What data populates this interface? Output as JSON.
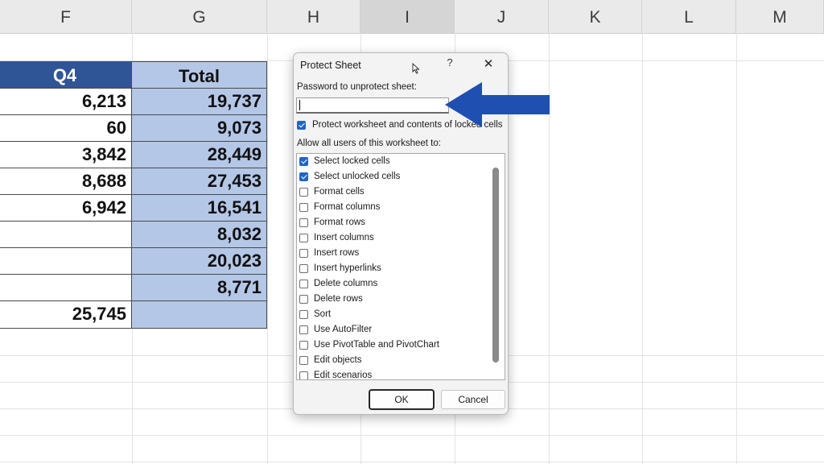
{
  "columns": [
    "F",
    "G",
    "H",
    "I",
    "J",
    "K",
    "L",
    "M"
  ],
  "selected_column": "I",
  "table": {
    "q4_header": "Q4",
    "total_header": "Total",
    "q4_values": [
      "6,213",
      "60",
      "3,842",
      "8,688",
      "6,942",
      "",
      "",
      "",
      "25,745"
    ],
    "total_values": [
      "19,737",
      "9,073",
      "28,449",
      "27,453",
      "16,541",
      "8,032",
      "20,023",
      "8,771",
      ""
    ]
  },
  "dialog": {
    "title": "Protect Sheet",
    "help": "?",
    "close": "✕",
    "password_label": "Password to unprotect sheet:",
    "password_value": "",
    "protect_label": "Protect worksheet and contents of locked cells",
    "protect_checked": true,
    "allow_label": "Allow all users of this worksheet to:",
    "options": [
      {
        "label": "Select locked cells",
        "checked": true
      },
      {
        "label": "Select unlocked cells",
        "checked": true
      },
      {
        "label": "Format cells",
        "checked": false
      },
      {
        "label": "Format columns",
        "checked": false
      },
      {
        "label": "Format rows",
        "checked": false
      },
      {
        "label": "Insert columns",
        "checked": false
      },
      {
        "label": "Insert rows",
        "checked": false
      },
      {
        "label": "Insert hyperlinks",
        "checked": false
      },
      {
        "label": "Delete columns",
        "checked": false
      },
      {
        "label": "Delete rows",
        "checked": false
      },
      {
        "label": "Sort",
        "checked": false
      },
      {
        "label": "Use AutoFilter",
        "checked": false
      },
      {
        "label": "Use PivotTable and PivotChart",
        "checked": false
      },
      {
        "label": "Edit objects",
        "checked": false
      },
      {
        "label": "Edit scenarios",
        "checked": false
      }
    ],
    "ok_label": "OK",
    "cancel_label": "Cancel"
  },
  "colors": {
    "q4_header_bg": "#2f5597",
    "total_col_bg": "#b4c7e7",
    "arrow": "#1f4fb0",
    "checkbox_on": "#1f66c5"
  }
}
